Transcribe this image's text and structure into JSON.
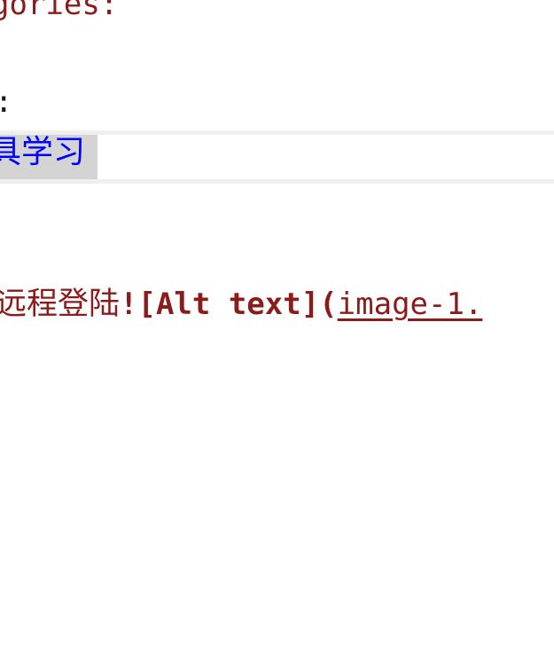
{
  "editor": {
    "lines": {
      "categories_key": "gories:",
      "tags_key": ":",
      "tag_value": "具学习",
      "body_prefix": "远程登陆",
      "image_syntax": "![Alt text](",
      "image_path": "image-1."
    }
  }
}
